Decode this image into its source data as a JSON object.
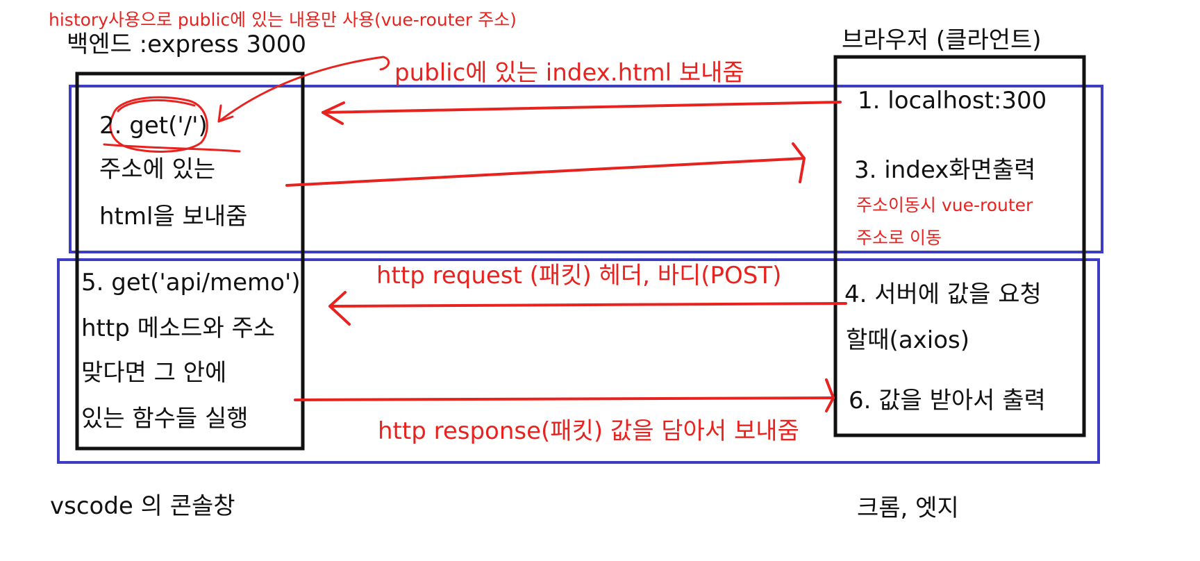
{
  "colors": {
    "ink": "#111111",
    "annotation": "#e8231f",
    "group_box": "#3d3dc4"
  },
  "header_note": "history사용으로 public에 있는 내용만 사용(vue-router 주소)",
  "backend": {
    "title": "백엔드 :express 3000",
    "step2": [
      "2. get('/')",
      "주소에 있는",
      "html을 보내줌"
    ],
    "step5": [
      "5. get('api/memo')",
      "http 메소드와 주소",
      "맞다면 그 안에",
      "있는 함수들 실행"
    ],
    "caption": "vscode 의 콘솔창"
  },
  "browser": {
    "title": "브라우저 (클라언트)",
    "step1": "1. localhost:300",
    "step3": "3. index화면출력",
    "step3_note": [
      "주소이동시 vue-router",
      "주소로 이동"
    ],
    "step4": [
      "4. 서버에 값을 요청",
      "할때(axios)"
    ],
    "step6": "6. 값을 받아서 출력",
    "caption": "크롬, 엣지"
  },
  "arrows": {
    "index_label": "public에 있는 index.html 보내줌",
    "request_label": "http request (패킷) 헤더, 바디(POST)",
    "response_label": "http response(패킷) 값을 담아서 보내줌"
  }
}
